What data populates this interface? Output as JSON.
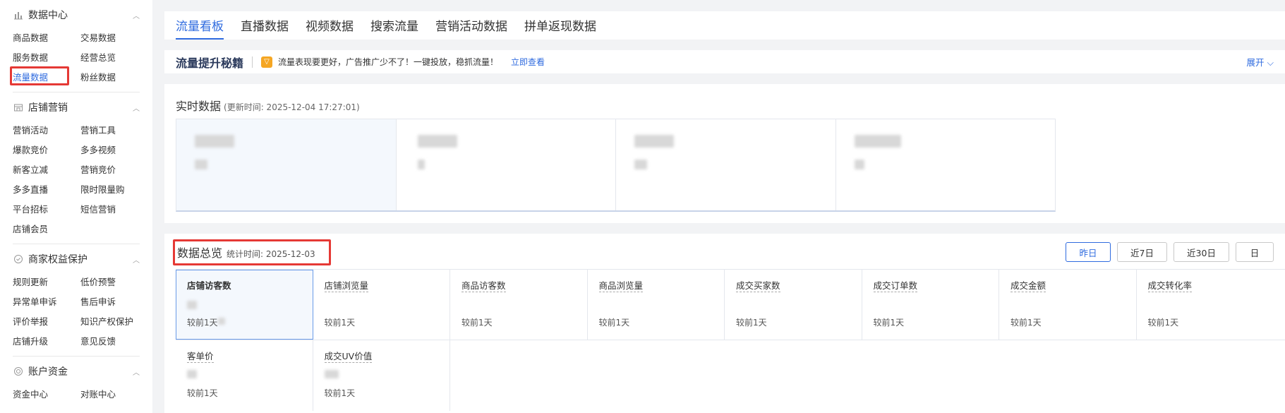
{
  "sidebar": {
    "groups": [
      {
        "icon": "bar-chart-icon",
        "title": "数据中心",
        "items": [
          "商品数据",
          "交易数据",
          "服务数据",
          "经营总览",
          "流量数据",
          "粉丝数据"
        ],
        "active": "流量数据"
      },
      {
        "icon": "store-icon",
        "title": "店铺营销",
        "items": [
          "营销活动",
          "营销工具",
          "爆款竞价",
          "多多视频",
          "新客立减",
          "营销竞价",
          "多多直播",
          "限时限量购",
          "平台招标",
          "短信营销",
          "店铺会员"
        ]
      },
      {
        "icon": "shield-icon",
        "title": "商家权益保护",
        "items": [
          "规则更新",
          "低价预警",
          "异常单申诉",
          "售后申诉",
          "评价举报",
          "知识产权保护",
          "店铺升级",
          "意见反馈"
        ]
      },
      {
        "icon": "coin-icon",
        "title": "账户资金",
        "items": [
          "资金中心",
          "对账中心"
        ]
      }
    ]
  },
  "tabs": [
    "流量看板",
    "直播数据",
    "视频数据",
    "搜索流量",
    "营销活动数据",
    "拼单返现数据"
  ],
  "active_tab": "流量看板",
  "promo": {
    "title": "流量提升秘籍",
    "text": "流量表现要更好，广告推广少不了！一键投放，稳抓流量！",
    "link": "立即查看",
    "expand": "展开 ⌵"
  },
  "realtime": {
    "title": "实时数据",
    "updated": "(更新时间: 2025-12-04 17:27:01)"
  },
  "overview": {
    "title": "数据总览",
    "stat_time": "统计时间:  2025-12-03",
    "buttons": [
      "昨日",
      "近7日",
      "近30日",
      "日"
    ],
    "active_button": "昨日",
    "metrics_row1": [
      "店铺访客数",
      "店铺浏览量",
      "商品访客数",
      "商品浏览量",
      "成交买家数",
      "成交订单数",
      "成交金额",
      "成交转化率"
    ],
    "metrics_row2": [
      "客单价",
      "成交UV价值"
    ],
    "compare_label": "较前1天"
  },
  "colors": {
    "accent": "#2f6bdf",
    "highlight": "#e53935"
  }
}
